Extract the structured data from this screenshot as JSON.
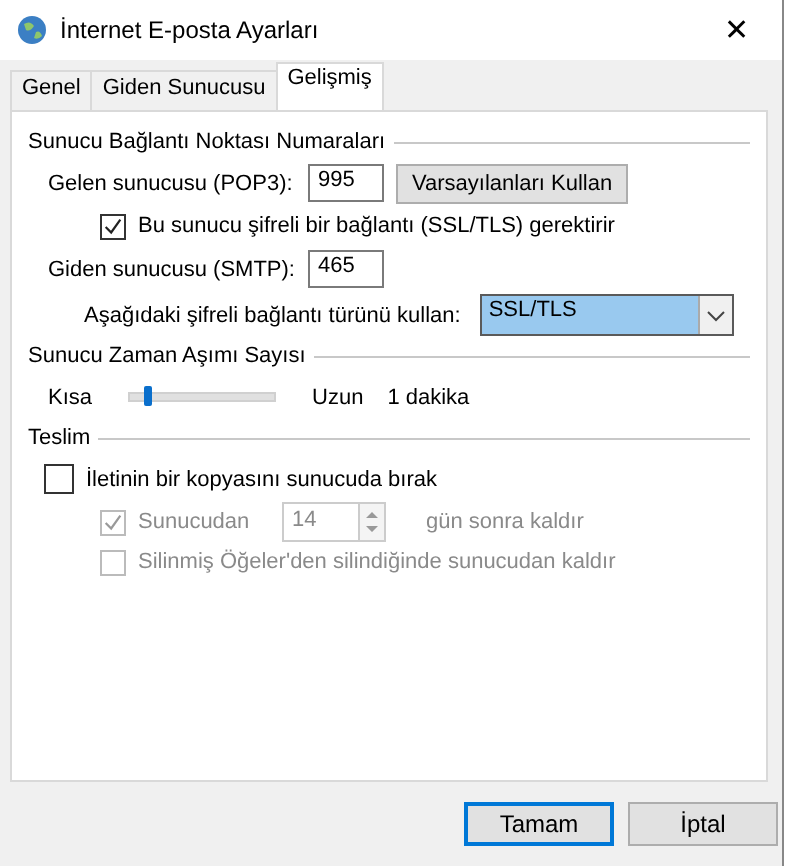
{
  "window": {
    "title": "İnternet E-posta Ayarları",
    "close": "✕"
  },
  "tabs": [
    {
      "label": "Genel",
      "selected": false
    },
    {
      "label": "Giden Sunucusu",
      "selected": false
    },
    {
      "label": "Gelişmiş",
      "selected": true
    }
  ],
  "ports": {
    "title": "Sunucu Bağlantı Noktası Numaraları",
    "incoming_label": "Gelen sunucusu (POP3):",
    "incoming_value": "995",
    "defaults_button": "Varsayılanları Kullan",
    "ssl_required": {
      "label": "Bu sunucu şifreli bir bağlantı (SSL/TLS) gerektirir",
      "checked": true
    },
    "outgoing_label": "Giden sunucusu (SMTP):",
    "outgoing_value": "465",
    "encryption_label": "Aşağıdaki şifreli bağlantı türünü kullan:",
    "encryption_value": "SSL/TLS"
  },
  "timeout": {
    "title": "Sunucu Zaman Aşımı Sayısı",
    "short_label": "Kısa",
    "long_label": "Uzun",
    "level": 0.1,
    "reading": "1 dakika"
  },
  "delivery": {
    "title": "Teslim",
    "leave_copy": {
      "label": "İletinin bir kopyasını sunucuda bırak",
      "checked": false
    },
    "remove_after": {
      "label": "Sunucudan",
      "checked": true,
      "disabled": true,
      "value": "14",
      "suffix": "gün sonra kaldır"
    },
    "remove_deleted": {
      "label": "Silinmiş Öğeler'den silindiğinde sunucudan kaldır",
      "checked": false,
      "disabled": true
    }
  },
  "buttons": [
    {
      "label": "Tamam",
      "default": true
    },
    {
      "label": "İptal",
      "default": false
    }
  ]
}
